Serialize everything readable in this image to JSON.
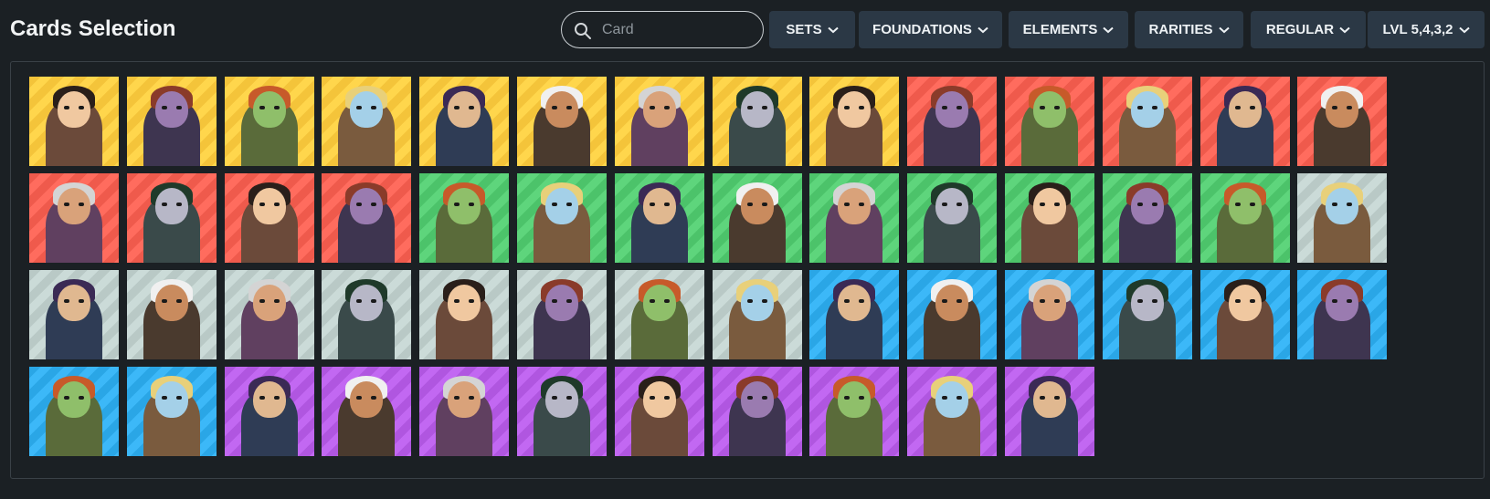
{
  "header": {
    "title": "Cards Selection",
    "search": {
      "placeholder": "Card",
      "value": ""
    },
    "filters": [
      {
        "label": "SETS"
      },
      {
        "label": "FOUNDATIONS"
      },
      {
        "label": "ELEMENTS"
      },
      {
        "label": "RARITIES"
      },
      {
        "label": "REGULAR"
      },
      {
        "label": "LVL 5,4,3,2"
      }
    ]
  },
  "colors": {
    "background": "#1b2024",
    "filter_button": "#2b3845",
    "life": "#f4c43a",
    "fire": "#ef5a4c",
    "earth": "#4cc36a",
    "neutral": "#b9c9c6",
    "water": "#2aa6e6",
    "death": "#b056e0"
  },
  "cards": {
    "rows": [
      [
        "life",
        "life",
        "life",
        "life",
        "life",
        "life",
        "life",
        "life",
        "life",
        "fire",
        "fire",
        "fire",
        "fire",
        "fire"
      ],
      [
        "fire",
        "fire",
        "fire",
        "fire",
        "earth",
        "earth",
        "earth",
        "earth",
        "earth",
        "earth",
        "earth",
        "earth",
        "earth",
        "neutral"
      ],
      [
        "neutral",
        "neutral",
        "neutral",
        "neutral",
        "neutral",
        "neutral",
        "neutral",
        "neutral",
        "water",
        "water",
        "water",
        "water",
        "water",
        "water"
      ],
      [
        "water",
        "water",
        "death",
        "death",
        "death",
        "death",
        "death",
        "death",
        "death",
        "death",
        "death"
      ]
    ]
  }
}
